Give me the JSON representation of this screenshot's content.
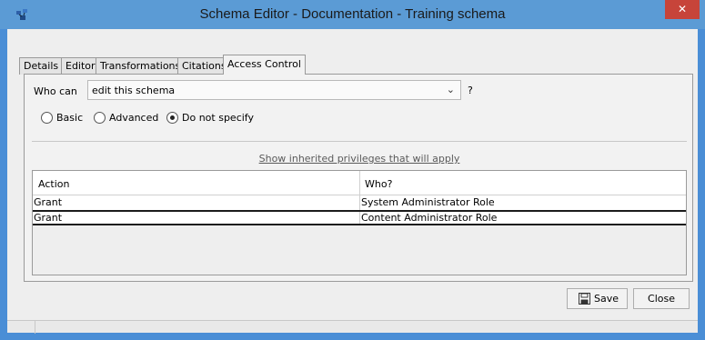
{
  "window": {
    "title": "Schema Editor - Documentation - Training schema",
    "close_glyph": "✕",
    "title_bar_color": "#5b9bd5",
    "close_button_color": "#c7443a"
  },
  "tabs": [
    {
      "label": "Details",
      "active": false
    },
    {
      "label": "Editor",
      "active": false
    },
    {
      "label": "Transformations",
      "active": false
    },
    {
      "label": "Citations",
      "active": false
    },
    {
      "label": "Access Control",
      "active": true
    }
  ],
  "access": {
    "who_can_label": "Who can",
    "who_can_value": "edit this schema",
    "help_mark": "?",
    "mode_options": [
      {
        "label": "Basic",
        "selected": false
      },
      {
        "label": "Advanced",
        "selected": false
      },
      {
        "label": "Do not specify",
        "selected": true
      }
    ],
    "inherit_link": "Show inherited privileges that will apply"
  },
  "table": {
    "columns": [
      "Action",
      "Who?"
    ],
    "rows": [
      {
        "action": "Grant",
        "who": "System Administrator Role",
        "selected": false
      },
      {
        "action": "Grant",
        "who": "Content Administrator Role",
        "selected": true
      }
    ]
  },
  "buttons": {
    "save": "Save",
    "close": "Close"
  },
  "icons": {
    "app": "schema-app-icon",
    "save": "floppy-disk-icon",
    "dropdown": "chevron-down-icon"
  }
}
